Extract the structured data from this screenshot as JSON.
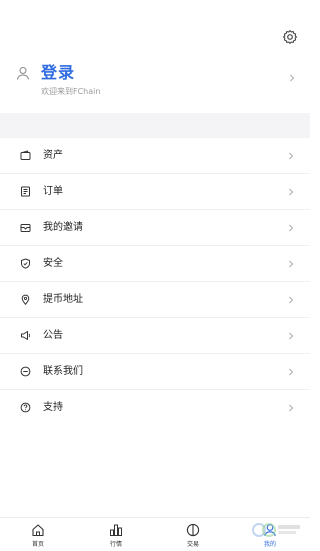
{
  "header": {
    "settings_icon": "gear-icon"
  },
  "login": {
    "title": "登录",
    "subtitle": "欢迎来到FChain",
    "icon": "user-icon"
  },
  "menu": [
    {
      "label": "资产",
      "icon": "wallet-icon"
    },
    {
      "label": "订单",
      "icon": "order-icon"
    },
    {
      "label": "我的邀请",
      "icon": "invite-icon"
    },
    {
      "label": "安全",
      "icon": "shield-icon"
    },
    {
      "label": "提币地址",
      "icon": "location-icon"
    },
    {
      "label": "公告",
      "icon": "speaker-icon"
    },
    {
      "label": "联系我们",
      "icon": "chat-icon"
    },
    {
      "label": "支持",
      "icon": "help-icon"
    }
  ],
  "tabbar": [
    {
      "label": "首页",
      "icon": "home-icon",
      "active": false
    },
    {
      "label": "行情",
      "icon": "market-icon",
      "active": false
    },
    {
      "label": "交易",
      "icon": "trade-icon",
      "active": false
    },
    {
      "label": "我的",
      "icon": "profile-icon",
      "active": true
    }
  ],
  "colors": {
    "accent": "#2f6be0",
    "divider": "#f0f0f0",
    "section_gap": "#f4f4f6",
    "muted": "#9a9a9a"
  }
}
